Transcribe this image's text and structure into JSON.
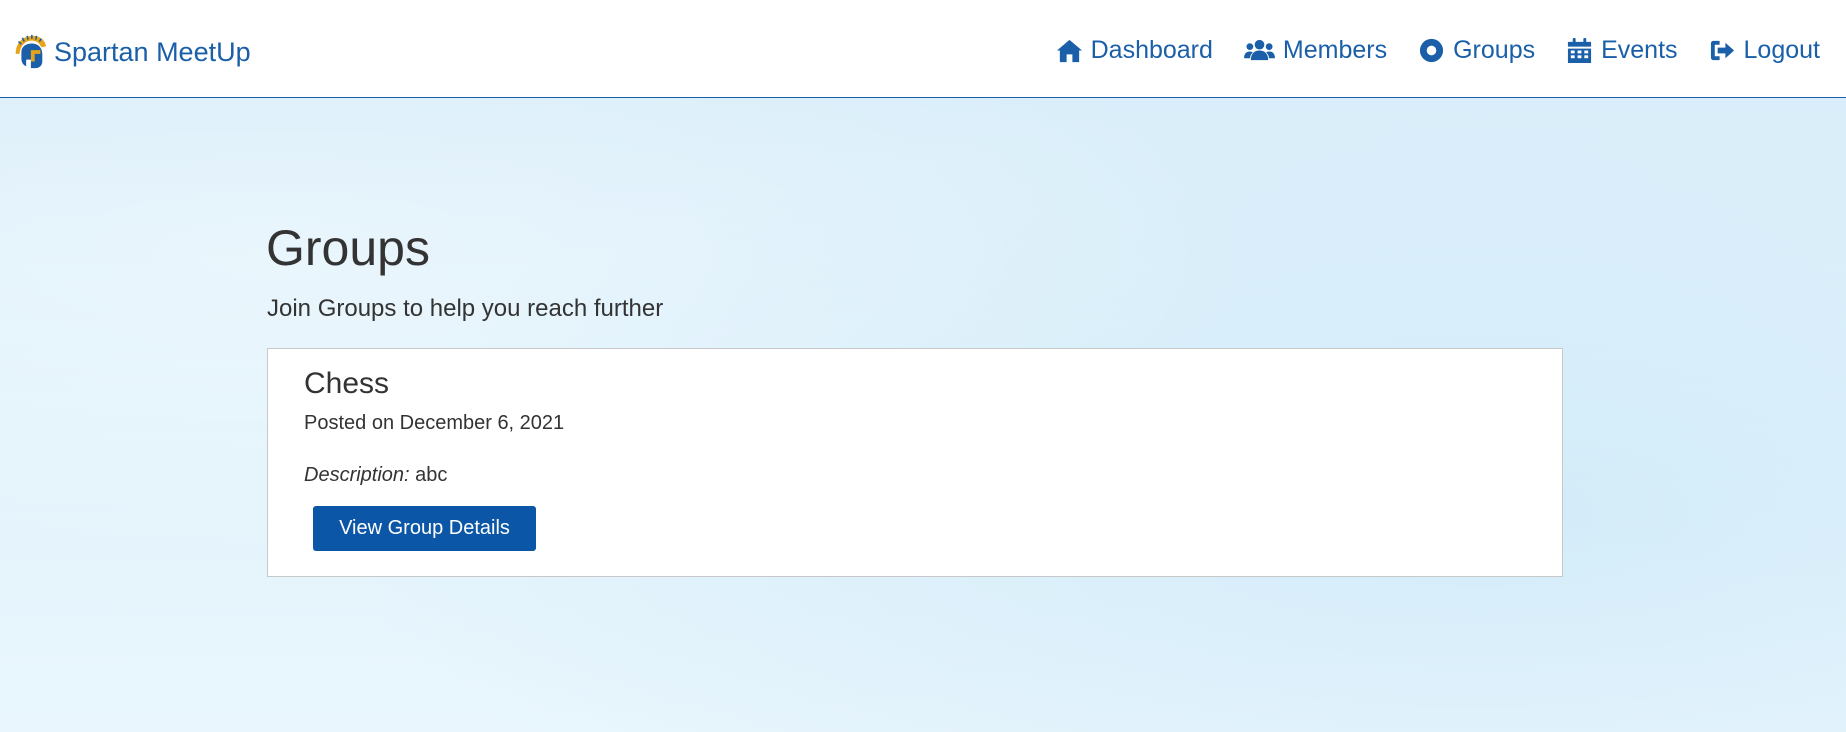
{
  "brand": {
    "name": "Spartan MeetUp",
    "logo_icon": "spartan-helmet-icon"
  },
  "nav": {
    "items": [
      {
        "label": "Dashboard",
        "icon": "home-icon"
      },
      {
        "label": "Members",
        "icon": "users-icon"
      },
      {
        "label": "Groups",
        "icon": "dot-circle-icon"
      },
      {
        "label": "Events",
        "icon": "calendar-icon"
      },
      {
        "label": "Logout",
        "icon": "logout-icon"
      }
    ]
  },
  "main": {
    "title": "Groups",
    "subtitle": "Join Groups to help you reach further",
    "groups": [
      {
        "name": "Chess",
        "posted": "Posted on December 6, 2021",
        "description_label": "Description:",
        "description": "abc",
        "button_label": "View Group Details"
      }
    ]
  },
  "colors": {
    "brand_blue": "#1a5fa8",
    "button_blue": "#0b56a6",
    "logo_gold": "#e8a317",
    "background": "#dcf0fa"
  }
}
